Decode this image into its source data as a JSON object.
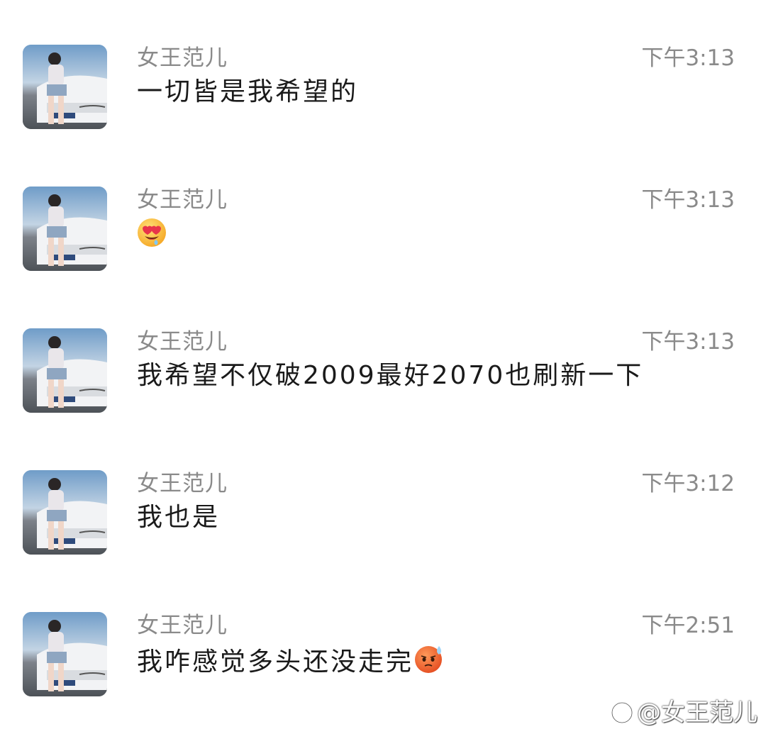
{
  "messages": [
    {
      "sender": "女王范儿",
      "time": "下午3:13",
      "text": "一切皆是我希望的",
      "emoji": ""
    },
    {
      "sender": "女王范儿",
      "time": "下午3:13",
      "text": "",
      "emoji": "heart-eyes-drooling-emoji"
    },
    {
      "sender": "女王范儿",
      "time": "下午3:13",
      "text": "我希望不仅破2009最好2070也刷新一下",
      "emoji": ""
    },
    {
      "sender": "女王范儿",
      "time": "下午3:12",
      "text": "我也是",
      "emoji": ""
    },
    {
      "sender": "女王范儿",
      "time": "下午2:51",
      "text": "我咋感觉多头还没走完",
      "emoji": "angry-sweat-emoji"
    }
  ],
  "watermark": {
    "text": "@女王范儿",
    "logo": "zhihu-logo-icon"
  },
  "colors": {
    "name": "#8a8a8a",
    "time": "#8a8a8a",
    "text": "#1a1a1a",
    "background": "#ffffff"
  }
}
